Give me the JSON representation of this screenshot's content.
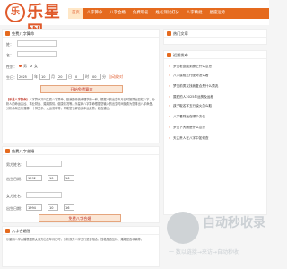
{
  "logo": {
    "mark": "乐",
    "text": "乐星网"
  },
  "nav": [
    {
      "label": "首页"
    },
    {
      "label": "八字算命"
    },
    {
      "label": "八字合婚"
    },
    {
      "label": "免费取名"
    },
    {
      "label": "姓名测试打分"
    },
    {
      "label": "八字精批"
    },
    {
      "label": "星座运势"
    },
    {
      "label": "解梦大全"
    }
  ],
  "bazi_form": {
    "title": "免费八字算命",
    "surname_label": "姓：",
    "name_label": "名：",
    "gender_label": "性别：",
    "gender_male": "男",
    "gender_female": "女",
    "birth_label": "生日：",
    "year": "2025",
    "year_unit": "年",
    "month": "10",
    "month_unit": "月",
    "day": "20",
    "day_unit": "日",
    "hour": "0",
    "hour_unit": "时",
    "minute": "00",
    "minute_unit": "分",
    "auto_label": "自动校对",
    "submit": "开始免费算命",
    "intro_title": "【乐星八字算命】",
    "intro": "八字算命又叫生辰八字算命，是我国传统命理学的一种，根据人的出生年月日时推算出四柱八字，分析人的命运吉凶、事业财运、婚姻感情、健康状况等。乐星网八字算命根据您输入的出生时间免费为您排出八字命盘，分析命局五行强弱、十神关系、大运流年等，帮助您了解自身命运走势，趋吉避凶。"
  },
  "hehun_form": {
    "title": "免费八字合婚",
    "male_name_label": "男方姓名：",
    "male_birth_label": "出生日期：",
    "male_year": "1992",
    "male_month": "10",
    "male_day": "16",
    "female_name_label": "女方姓名：",
    "female_birth_label": "出生日期：",
    "female_year": "1994",
    "female_month": "10",
    "female_day": "16",
    "submit": "免费八字合婚"
  },
  "hot_articles": {
    "title": "热门文章"
  },
  "latest": {
    "title": "近期发布",
    "items": [
      "梦见老鼠爬到身上什么意思",
      "八字属相五行配对怎么看",
      "梦见前男友找我复合是什么预兆",
      "属蛇的人2025年运势及运程",
      "孩子取名字五行缺火怎么取",
      "八字看财运在哪个方位",
      "梦见下大雨是什么意思",
      "天乙贵人在八字中如何查"
    ]
  },
  "bottom": {
    "title": "八字合婚答",
    "text": "乐星网八字合婚根据男女双方出生年月日时，分析双方八字五行是否相合、性格是否互补、婚姻是否和谐等。"
  },
  "watermark": {
    "main": "自动秒收录",
    "sub": "一 数以链接→来访→自动秒收"
  }
}
